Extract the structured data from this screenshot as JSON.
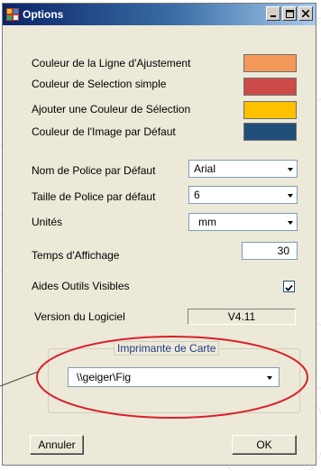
{
  "window": {
    "title": "Options"
  },
  "colors": {
    "line": "#f4985a",
    "selection": "#cc4a48",
    "add_selection": "#ffc000",
    "default_image": "#1f4e79",
    "annotation": "#d9202a"
  },
  "labels": {
    "line_color": "Couleur de la Ligne d'Ajustement",
    "selection_color": "Couleur de Selection simple",
    "add_selection_color": "Ajouter une Couleur de Sélection",
    "image_color": "Couleur de l'Image par Défaut",
    "font_name": "Nom de Police par Défaut",
    "font_size": "Taille de Police par défaut",
    "units": "Unités",
    "display_time": "Temps d'Affichage",
    "tooltips": "Aides Outils Visibles",
    "version": "Version du Logiciel"
  },
  "fields": {
    "font_name": "Arial",
    "font_size": "6",
    "units": "mm",
    "display_time": "30",
    "tooltips_checked": true,
    "version": "V4.11"
  },
  "printer": {
    "group_label": "Imprimante de Carte",
    "value": "\\\\geiger\\Fig"
  },
  "buttons": {
    "cancel": "Annuler",
    "ok": "OK"
  }
}
